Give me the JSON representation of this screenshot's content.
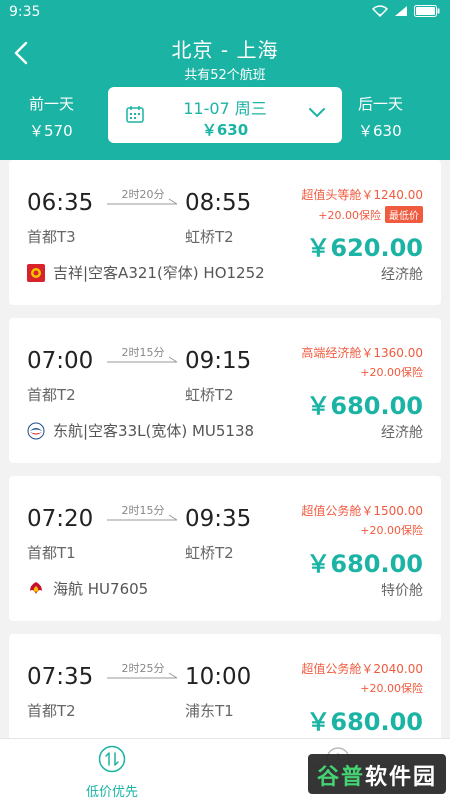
{
  "status_bar": {
    "time": "9:35"
  },
  "header": {
    "title": "北京 - 上海",
    "subtitle": "共有52个航班",
    "prev_day": {
      "label": "前一天",
      "price": "￥570"
    },
    "next_day": {
      "label": "后一天",
      "price": "￥630"
    },
    "date": {
      "text": "11-07 周三",
      "price": "￥630"
    }
  },
  "flights": [
    {
      "dep_time": "06:35",
      "dep_airport": "首都T3",
      "arr_time": "08:55",
      "arr_airport": "虹桥T2",
      "duration": "2时20分",
      "airline": "吉祥|空客A321(窄体) HO1252",
      "cabin_price": "超值头等舱￥1240.00",
      "insurance": "+20.00保险",
      "badge": "最低价",
      "price": "￥620.00",
      "cabin_class": "经济舱",
      "logo_color": "#d8232a"
    },
    {
      "dep_time": "07:00",
      "dep_airport": "首都T2",
      "arr_time": "09:15",
      "arr_airport": "虹桥T2",
      "duration": "2时15分",
      "airline": "东航|空客33L(宽体) MU5138",
      "cabin_price": "高端经济舱￥1360.00",
      "insurance": "+20.00保险",
      "price": "￥680.00",
      "cabin_class": "经济舱",
      "logo_color": "#1c4e8c"
    },
    {
      "dep_time": "07:20",
      "dep_airport": "首都T1",
      "arr_time": "09:35",
      "arr_airport": "虹桥T2",
      "duration": "2时15分",
      "airline": "海航 HU7605",
      "cabin_price": "超值公务舱￥1500.00",
      "insurance": "+20.00保险",
      "price": "￥680.00",
      "cabin_class": "特价舱",
      "logo_color": "#c8102e"
    },
    {
      "dep_time": "07:35",
      "dep_airport": "首都T2",
      "arr_time": "10:00",
      "arr_airport": "浦东T1",
      "duration": "2时25分",
      "cabin_price": "超值公务舱￥2040.00",
      "insurance": "+20.00保险",
      "price": "￥680.00"
    }
  ],
  "bottom_bar": {
    "sort_label": "低价优先"
  },
  "watermark": {
    "text_a": "谷普",
    "text_b": "软件园"
  },
  "colors": {
    "accent": "#1bb3a4",
    "warning": "#f05a3e"
  }
}
